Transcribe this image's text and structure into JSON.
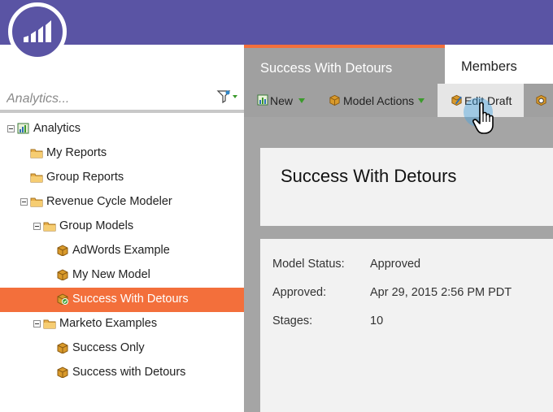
{
  "header": {
    "logo_icon": "marketo-logo-icon",
    "brand_color": "#5a54a4"
  },
  "search": {
    "placeholder": "Analytics...",
    "filter_icon": "filter-icon"
  },
  "tree": {
    "items": [
      {
        "label": "Analytics",
        "icon": "analytics-root-icon",
        "expanded": true
      },
      {
        "label": "My Reports",
        "icon": "folder-icon"
      },
      {
        "label": "Group Reports",
        "icon": "folder-icon"
      },
      {
        "label": "Revenue Cycle Modeler",
        "icon": "folder-icon",
        "expanded": true
      },
      {
        "label": "Group Models",
        "icon": "folder-icon",
        "expanded": true
      },
      {
        "label": "AdWords Example",
        "icon": "model-icon"
      },
      {
        "label": "My New Model",
        "icon": "model-icon"
      },
      {
        "label": "Success With Detours",
        "icon": "approved-model-icon",
        "selected": true
      },
      {
        "label": "Marketo Examples",
        "icon": "folder-icon",
        "expanded": true
      },
      {
        "label": "Success Only",
        "icon": "model-icon"
      },
      {
        "label": "Success with Detours",
        "icon": "model-icon"
      }
    ],
    "selected_color": "#f36f3b"
  },
  "tabs": {
    "active": "Success With Detours",
    "members": "Members",
    "accent": "#f36f3b"
  },
  "toolbar": {
    "new_label": "New",
    "model_actions_label": "Model Actions",
    "edit_draft_label": "Edit Draft"
  },
  "model": {
    "title": "Success With Detours",
    "status_label": "Model Status:",
    "status_value": "Approved",
    "approved_label": "Approved:",
    "approved_value": "Apr 29, 2015 2:56 PM PDT",
    "stages_label": "Stages:",
    "stages_value": "10"
  }
}
